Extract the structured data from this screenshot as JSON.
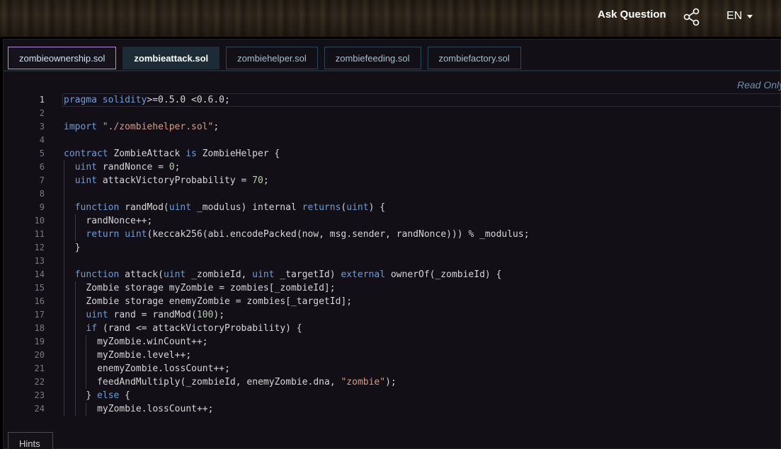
{
  "header": {
    "ask_question": "Ask Question",
    "language": "EN"
  },
  "tabs": [
    {
      "label": "zombieownership.sol",
      "state": "outlined"
    },
    {
      "label": "zombieattack.sol",
      "state": "active"
    },
    {
      "label": "zombiehelper.sol",
      "state": "default"
    },
    {
      "label": "zombiefeeding.sol",
      "state": "default"
    },
    {
      "label": "zombiefactory.sol",
      "state": "default"
    }
  ],
  "editor": {
    "read_only_label": "Read Only",
    "current_line": 1,
    "lines": [
      {
        "n": "1",
        "indent": 0,
        "tokens": [
          [
            "kw",
            "pragma solidity"
          ],
          [
            "",
            ">=0.5.0 <0.6.0;"
          ]
        ]
      },
      {
        "n": "2",
        "indent": 0,
        "tokens": []
      },
      {
        "n": "3",
        "indent": 0,
        "tokens": [
          [
            "kw",
            "import"
          ],
          [
            "",
            " "
          ],
          [
            "str",
            "\"./zombiehelper.sol\""
          ],
          [
            "",
            ";"
          ]
        ]
      },
      {
        "n": "4",
        "indent": 0,
        "tokens": []
      },
      {
        "n": "5",
        "indent": 0,
        "tokens": [
          [
            "kw",
            "contract"
          ],
          [
            "",
            " ZombieAttack "
          ],
          [
            "kw",
            "is"
          ],
          [
            "",
            " ZombieHelper {"
          ]
        ]
      },
      {
        "n": "6",
        "indent": 1,
        "tokens": [
          [
            "kw",
            "uint"
          ],
          [
            "",
            " randNonce = "
          ],
          [
            "num",
            "0"
          ],
          [
            "",
            ";"
          ]
        ]
      },
      {
        "n": "7",
        "indent": 1,
        "tokens": [
          [
            "kw",
            "uint"
          ],
          [
            "",
            " attackVictoryProbability = "
          ],
          [
            "num",
            "70"
          ],
          [
            "",
            ";"
          ]
        ]
      },
      {
        "n": "8",
        "indent": 1,
        "tokens": []
      },
      {
        "n": "9",
        "indent": 1,
        "tokens": [
          [
            "kw",
            "function"
          ],
          [
            "",
            " randMod("
          ],
          [
            "kw",
            "uint"
          ],
          [
            "",
            " _modulus) internal "
          ],
          [
            "kw",
            "returns"
          ],
          [
            "",
            "("
          ],
          [
            "kw",
            "uint"
          ],
          [
            "",
            ") {"
          ]
        ]
      },
      {
        "n": "10",
        "indent": 2,
        "tokens": [
          [
            "",
            "randNonce++;"
          ]
        ]
      },
      {
        "n": "11",
        "indent": 2,
        "tokens": [
          [
            "kw",
            "return"
          ],
          [
            "",
            " "
          ],
          [
            "kw",
            "uint"
          ],
          [
            "",
            "(keccak256(abi.encodePacked(now, msg.sender, randNonce))) % _modulus;"
          ]
        ]
      },
      {
        "n": "12",
        "indent": 1,
        "tokens": [
          [
            "",
            "}"
          ]
        ]
      },
      {
        "n": "13",
        "indent": 1,
        "tokens": []
      },
      {
        "n": "14",
        "indent": 1,
        "tokens": [
          [
            "kw",
            "function"
          ],
          [
            "",
            " attack("
          ],
          [
            "kw",
            "uint"
          ],
          [
            "",
            " _zombieId, "
          ],
          [
            "kw",
            "uint"
          ],
          [
            "",
            " _targetId) "
          ],
          [
            "kw",
            "external"
          ],
          [
            "",
            " ownerOf(_zombieId) {"
          ]
        ]
      },
      {
        "n": "15",
        "indent": 2,
        "tokens": [
          [
            "",
            "Zombie storage myZombie = zombies[_zombieId];"
          ]
        ]
      },
      {
        "n": "16",
        "indent": 2,
        "tokens": [
          [
            "",
            "Zombie storage enemyZombie = zombies[_targetId];"
          ]
        ]
      },
      {
        "n": "17",
        "indent": 2,
        "tokens": [
          [
            "kw",
            "uint"
          ],
          [
            "",
            " rand = randMod("
          ],
          [
            "num",
            "100"
          ],
          [
            "",
            ");"
          ]
        ]
      },
      {
        "n": "18",
        "indent": 2,
        "tokens": [
          [
            "kw",
            "if"
          ],
          [
            "",
            " (rand <= attackVictoryProbability) {"
          ]
        ]
      },
      {
        "n": "19",
        "indent": 3,
        "tokens": [
          [
            "",
            "myZombie.winCount++;"
          ]
        ]
      },
      {
        "n": "20",
        "indent": 3,
        "tokens": [
          [
            "",
            "myZombie.level++;"
          ]
        ]
      },
      {
        "n": "21",
        "indent": 3,
        "tokens": [
          [
            "",
            "enemyZombie.lossCount++;"
          ]
        ]
      },
      {
        "n": "22",
        "indent": 3,
        "tokens": [
          [
            "",
            "feedAndMultiply(_zombieId, enemyZombie.dna, "
          ],
          [
            "str",
            "\"zombie\""
          ],
          [
            "",
            ");"
          ]
        ]
      },
      {
        "n": "23",
        "indent": 2,
        "tokens": [
          [
            "",
            "} "
          ],
          [
            "kw",
            "else"
          ],
          [
            "",
            " {"
          ]
        ]
      },
      {
        "n": "24",
        "indent": 3,
        "tokens": [
          [
            "",
            "myZombie.lossCount++;"
          ]
        ]
      }
    ]
  },
  "hints_label": "Hints"
}
